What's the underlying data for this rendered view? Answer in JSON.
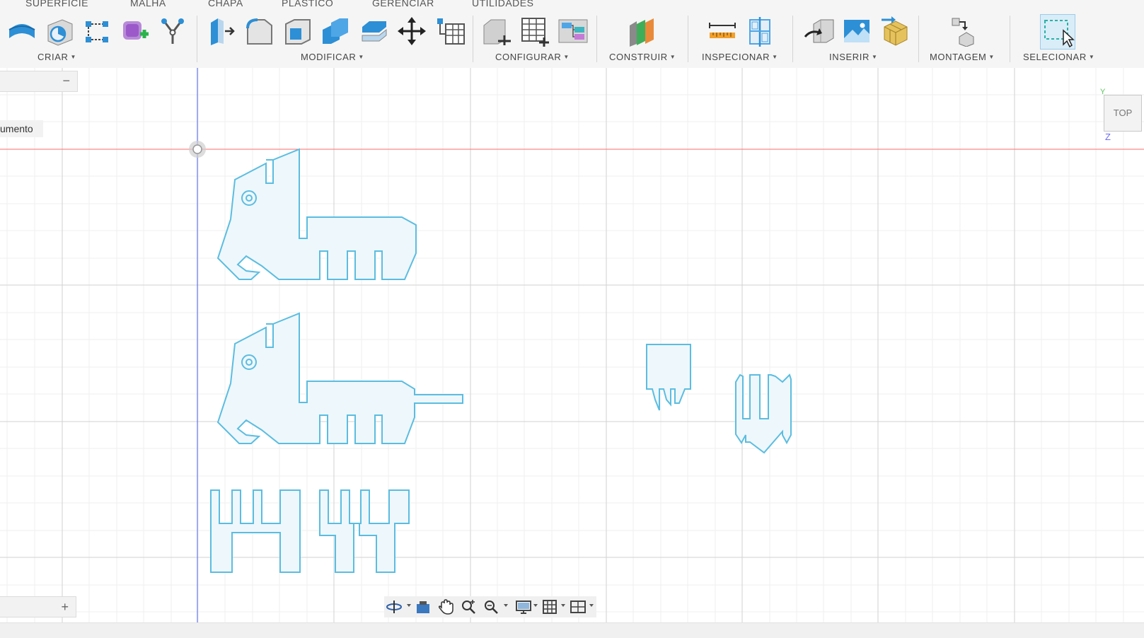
{
  "tabs": [
    "SUPERFÍCIE",
    "MALHA",
    "CHAPA",
    "PLÁSTICO",
    "GERENCIAR",
    "UTILIDADES"
  ],
  "groups": {
    "criar": "CRIAR",
    "modificar": "MODIFICAR",
    "configurar": "CONFIGURAR",
    "construir": "CONSTRUIR",
    "inspecionar": "INSPECIONAR",
    "inserir": "INSERIR",
    "montagem": "MONTAGEM",
    "selecionar": "SELECIONAR"
  },
  "browser": {
    "document_label": "umento",
    "collapse_symbol": "−"
  },
  "comments": {
    "expand_symbol": "+"
  },
  "viewcube": {
    "face": "TOP",
    "axis_y": "Y",
    "axis_z": "Z"
  },
  "colors": {
    "sketch_line": "#5bbde0",
    "sketch_fill": "#eef7fc",
    "x_axis": "#ff6b6b",
    "y_axis": "#4a5ff0",
    "accent_blue": "#2d8fd5"
  },
  "icons": {
    "criar": [
      "surface-extrude-icon",
      "surface-revolve-icon",
      "sketch-icon",
      "create-form-icon",
      "fork-tool-icon"
    ],
    "modificar": [
      "press-pull-icon",
      "fillet-icon",
      "shell-icon",
      "combine-icon",
      "offset-face-icon",
      "move-icon",
      "parameters-icon"
    ],
    "configurar": [
      "configure-part-icon",
      "configure-table-icon",
      "configure-rule-icon"
    ],
    "construir": [
      "offset-plane-icon"
    ],
    "inspecionar": [
      "measure-icon",
      "section-analysis-icon"
    ],
    "inserir": [
      "insert-derive-icon",
      "insert-canvas-icon",
      "insert-mesh-icon"
    ],
    "montagem": [
      "new-component-icon"
    ],
    "selecionar": [
      "window-select-icon"
    ]
  }
}
